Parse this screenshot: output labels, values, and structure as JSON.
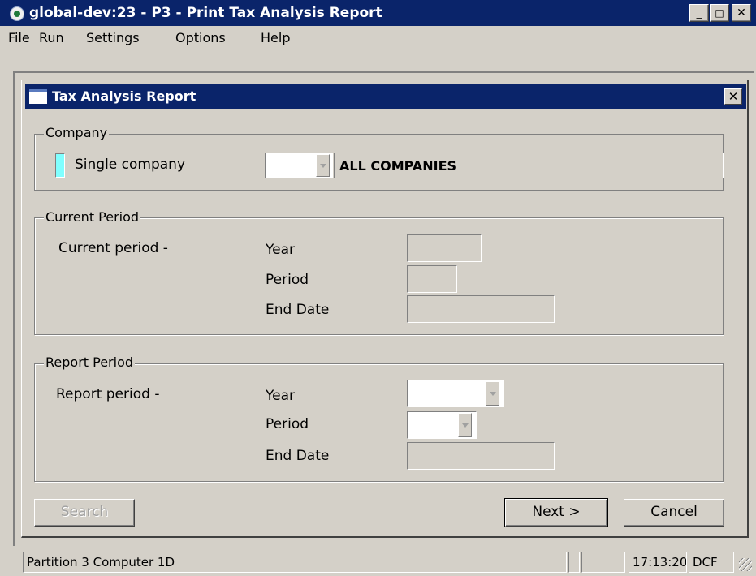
{
  "window": {
    "title": "global-dev:23 - P3 - Print Tax Analysis Report",
    "minimize_label": "_",
    "maximize_label": "□",
    "close_label": "✕"
  },
  "menu": [
    "File",
    "Run",
    "Settings",
    "Options",
    "Help"
  ],
  "dialog": {
    "title": "Tax Analysis Report",
    "close_label": "✕"
  },
  "company_group": {
    "legend": "Company",
    "single_company_label": "Single company",
    "company_code_value": "",
    "company_name_value": "ALL COMPANIES"
  },
  "current_period_group": {
    "legend": "Current Period",
    "section_label": "Current period -",
    "year_label": "Year",
    "year_value": "",
    "period_label": "Period",
    "period_value": "",
    "end_date_label": "End Date",
    "end_date_value": ""
  },
  "report_period_group": {
    "legend": "Report Period",
    "section_label": "Report period -",
    "year_label": "Year",
    "year_value": "",
    "period_label": "Period",
    "period_value": "",
    "end_date_label": "End Date",
    "end_date_value": ""
  },
  "buttons": {
    "search": "Search",
    "next": "Next >",
    "cancel": "Cancel"
  },
  "status": {
    "partition_text": "Partition 3 Computer 1D",
    "time": "17:13:20",
    "extra": "DCF"
  },
  "colors": {
    "titlebar": "#0a246a",
    "window_bg": "#d4d0c8",
    "checkbox_indicator": "#80ffff"
  }
}
